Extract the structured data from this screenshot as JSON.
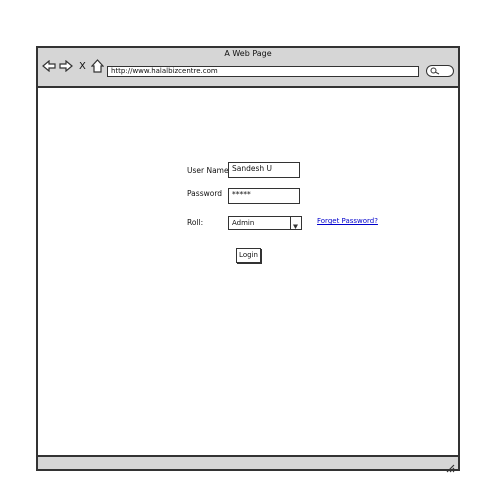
{
  "window": {
    "title": "A Web Page"
  },
  "toolbar": {
    "back_icon": "back-arrow-icon",
    "forward_icon": "forward-arrow-icon",
    "stop_label": "X",
    "home_icon": "home-icon",
    "url": "http://www.halalbizcentre.com",
    "search_icon": "search-icon"
  },
  "form": {
    "username_label": "User Name:",
    "username_value": "Sandesh U",
    "password_label": "Password",
    "password_value": "*****",
    "role_label": "Roll:",
    "role_selected": "Admin",
    "forgot_link": "Forget Password?",
    "login_label": "Login"
  },
  "colors": {
    "chrome": "#d6d6d6",
    "link": "#0000cc",
    "border": "#333333"
  }
}
